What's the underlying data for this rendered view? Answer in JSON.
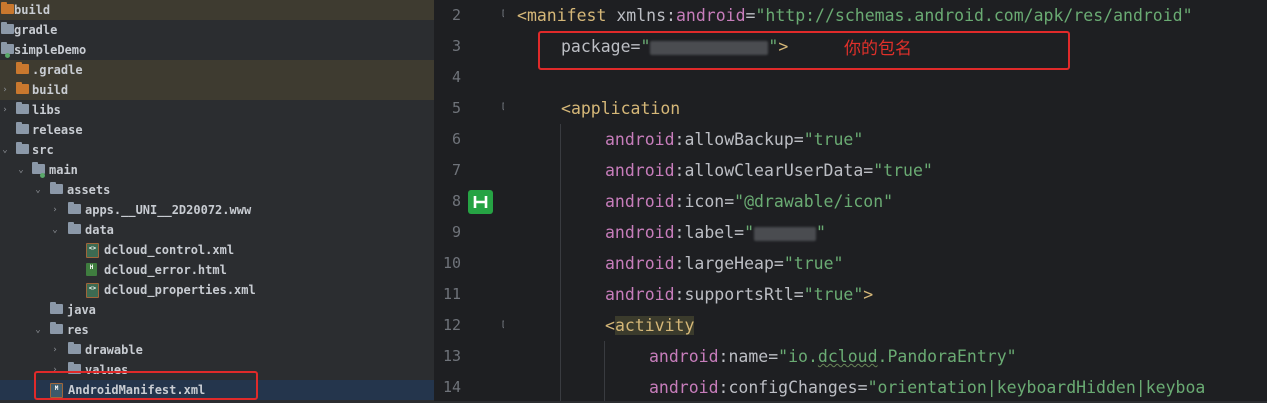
{
  "tree": {
    "items": [
      {
        "label": "build",
        "icon": "folder-orange"
      },
      {
        "label": "gradle",
        "icon": "folder"
      },
      {
        "label": "simpleDemo",
        "icon": "module"
      },
      {
        "label": ".gradle",
        "icon": "folder-orange"
      },
      {
        "label": "build",
        "icon": "folder-orange"
      },
      {
        "label": "libs",
        "icon": "folder"
      },
      {
        "label": "release",
        "icon": "folder"
      },
      {
        "label": "src",
        "icon": "folder"
      },
      {
        "label": "main",
        "icon": "folder"
      },
      {
        "label": "assets",
        "icon": "folder"
      },
      {
        "label": "apps.__UNI__2D20072.www",
        "icon": "folder"
      },
      {
        "label": "data",
        "icon": "folder"
      },
      {
        "label": "dcloud_control.xml",
        "icon": "xml-file"
      },
      {
        "label": "dcloud_error.html",
        "icon": "html-file"
      },
      {
        "label": "dcloud_properties.xml",
        "icon": "xml-file"
      },
      {
        "label": "java",
        "icon": "folder"
      },
      {
        "label": "res",
        "icon": "folder"
      },
      {
        "label": "drawable",
        "icon": "folder"
      },
      {
        "label": "values",
        "icon": "folder"
      },
      {
        "label": "AndroidManifest.xml",
        "icon": "manifest-file"
      }
    ]
  },
  "gutter": {
    "line_numbers": [
      "2",
      "3",
      "4",
      "5",
      "6",
      "7",
      "8",
      "9",
      "10",
      "11",
      "12",
      "13",
      "14"
    ],
    "badge_icon": "h-gutter-icon"
  },
  "code": {
    "l2": {
      "open": "<",
      "tag": "manifest",
      "space": " xmlns:",
      "ns": "android",
      "eq": "=",
      "val": "\"http://schemas.android.com/apk/res/android\""
    },
    "l3": {
      "attr": "package=",
      "q1": "\"",
      "q2": "\"",
      "close": ">"
    },
    "l5": {
      "open": "<",
      "tag": "application"
    },
    "l6": {
      "ns": "android",
      "attr": ":allowBackup=",
      "val": "\"true\""
    },
    "l7": {
      "ns": "android",
      "attr": ":allowClearUserData=",
      "val": "\"true\""
    },
    "l8": {
      "ns": "android",
      "attr": ":icon=",
      "val": "\"@drawable/icon\""
    },
    "l9": {
      "ns": "android",
      "attr": ":label=",
      "q1": "\"",
      "q2": "\""
    },
    "l10": {
      "ns": "android",
      "attr": ":largeHeap=",
      "val": "\"true\""
    },
    "l11": {
      "ns": "android",
      "attr": ":supportsRtl=",
      "val": "\"true\"",
      "close": ">"
    },
    "l12": {
      "open": "<",
      "tag": "activity"
    },
    "l13": {
      "ns": "android",
      "attr": ":name=",
      "val1": "\"io.",
      "val2": "dcloud",
      "val3": ".PandoraEntry\""
    },
    "l14": {
      "ns": "android",
      "attr": ":configChanges=",
      "val": "\"orientation|keyboardHidden|keyboa"
    }
  },
  "annotation": "你的包名",
  "colors": {
    "annotation": "#e0302a",
    "tag": "#d5b778",
    "namespace": "#c77dbb",
    "string": "#6aab73"
  }
}
